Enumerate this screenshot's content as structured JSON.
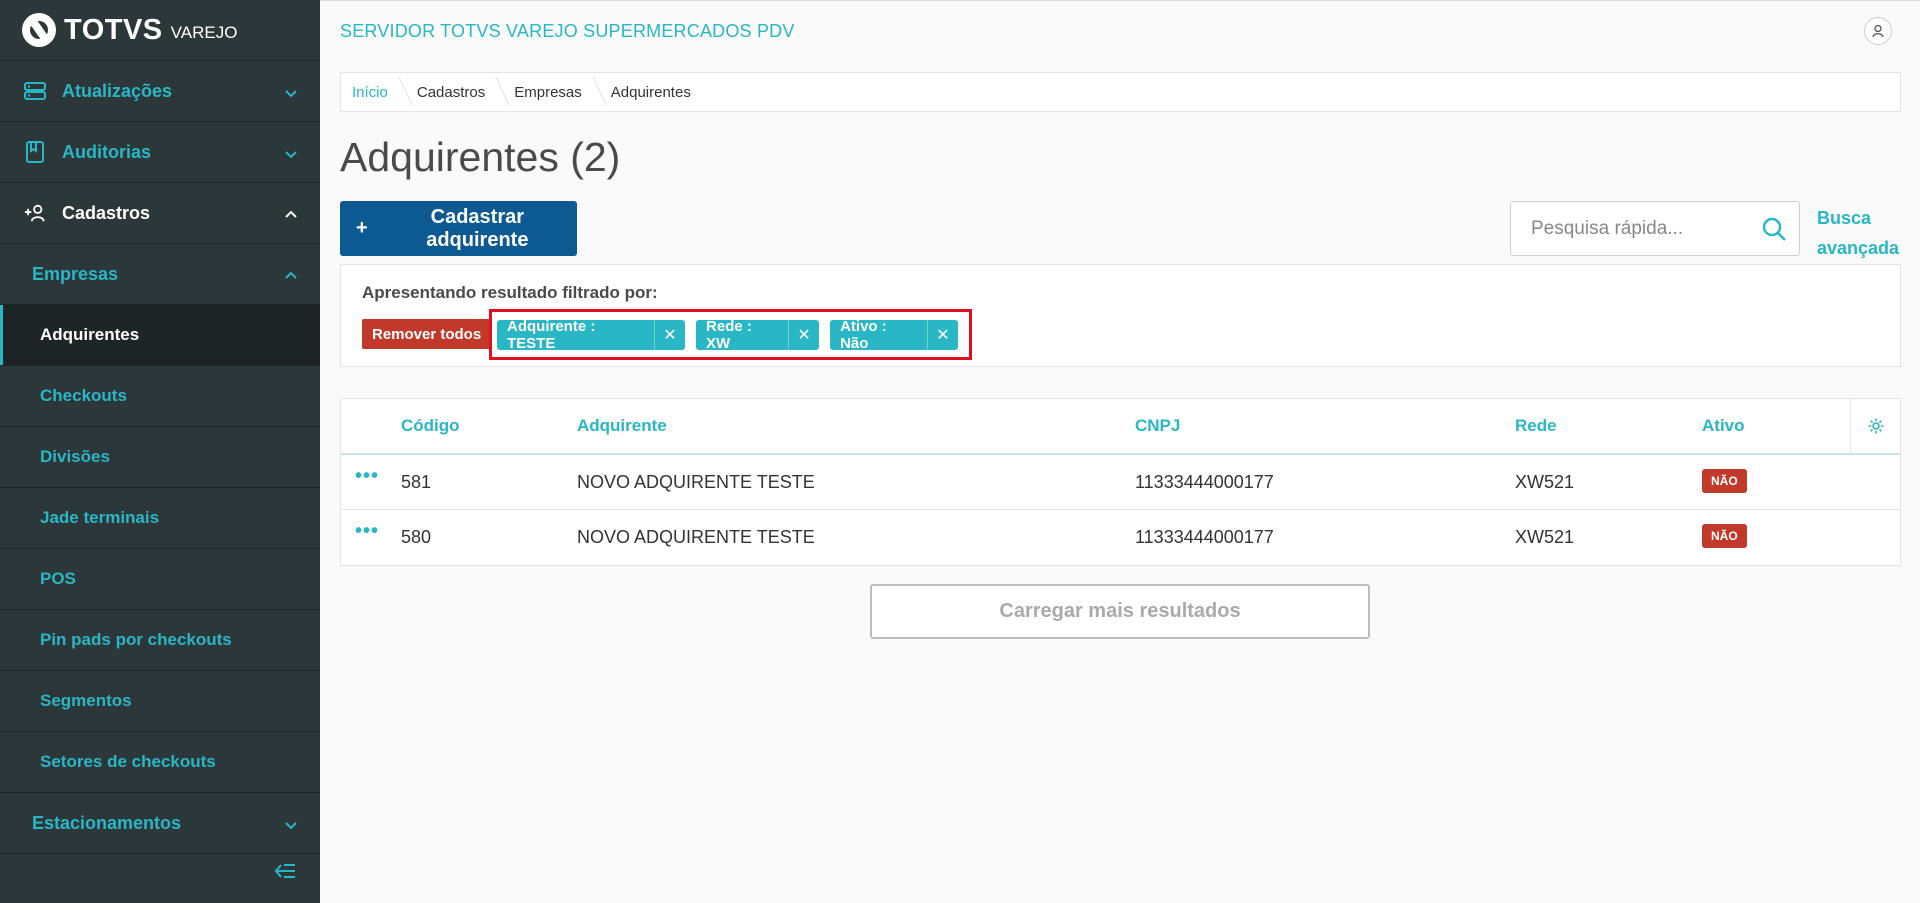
{
  "brand": {
    "name": "TOTVS",
    "product": "VAREJO"
  },
  "sidebar": {
    "items": [
      {
        "label": "Atualizações",
        "icon": "server-icon",
        "state": "collapsed"
      },
      {
        "label": "Auditorias",
        "icon": "book-icon",
        "state": "collapsed"
      },
      {
        "label": "Cadastros",
        "icon": "add-user-icon",
        "state": "expanded"
      }
    ],
    "group": {
      "label": "Empresas",
      "state": "expanded"
    },
    "subitems": [
      {
        "label": "Adquirentes",
        "active": true
      },
      {
        "label": "Checkouts"
      },
      {
        "label": "Divisões"
      },
      {
        "label": "Jade terminais"
      },
      {
        "label": "POS"
      },
      {
        "label": "Pin pads por checkouts"
      },
      {
        "label": "Segmentos"
      },
      {
        "label": "Setores de checkouts"
      }
    ],
    "next_group": {
      "label": "Estacionamentos",
      "state": "collapsed"
    }
  },
  "header": {
    "server_title": "SERVIDOR TOTVS VAREJO SUPERMERCADOS PDV"
  },
  "breadcrumb": [
    "Início",
    "Cadastros",
    "Empresas",
    "Adquirentes"
  ],
  "page": {
    "title": "Adquirentes (2)"
  },
  "toolbar": {
    "add_label": "Cadastrar adquirente",
    "add_icon": "+",
    "search_placeholder": "Pesquisa rápida...",
    "advanced_search_line1": "Busca",
    "advanced_search_line2": "avançada"
  },
  "filters": {
    "caption": "Apresentando resultado filtrado por:",
    "remove_all": "Remover todos",
    "chips": [
      {
        "label": "Adquirente : TESTE"
      },
      {
        "label": "Rede : XW"
      },
      {
        "label": "Ativo : Não"
      }
    ],
    "chip_close": "✕"
  },
  "table": {
    "columns": [
      "Código",
      "Adquirente",
      "CNPJ",
      "Rede",
      "Ativo"
    ],
    "rows": [
      {
        "actions": "•••",
        "codigo": "581",
        "adquirente": "NOVO ADQUIRENTE TESTE",
        "cnpj": "11333444000177",
        "rede": "XW521",
        "ativo": "NÃO"
      },
      {
        "actions": "•••",
        "codigo": "580",
        "adquirente": "NOVO ADQUIRENTE TESTE",
        "cnpj": "11333444000177",
        "rede": "XW521",
        "ativo": "NÃO"
      }
    ]
  },
  "load_more": "Carregar mais resultados",
  "colors": {
    "accent": "#29b6c5",
    "primary": "#0c5a91",
    "danger": "#c0392b",
    "sidebar": "#2c3739"
  }
}
